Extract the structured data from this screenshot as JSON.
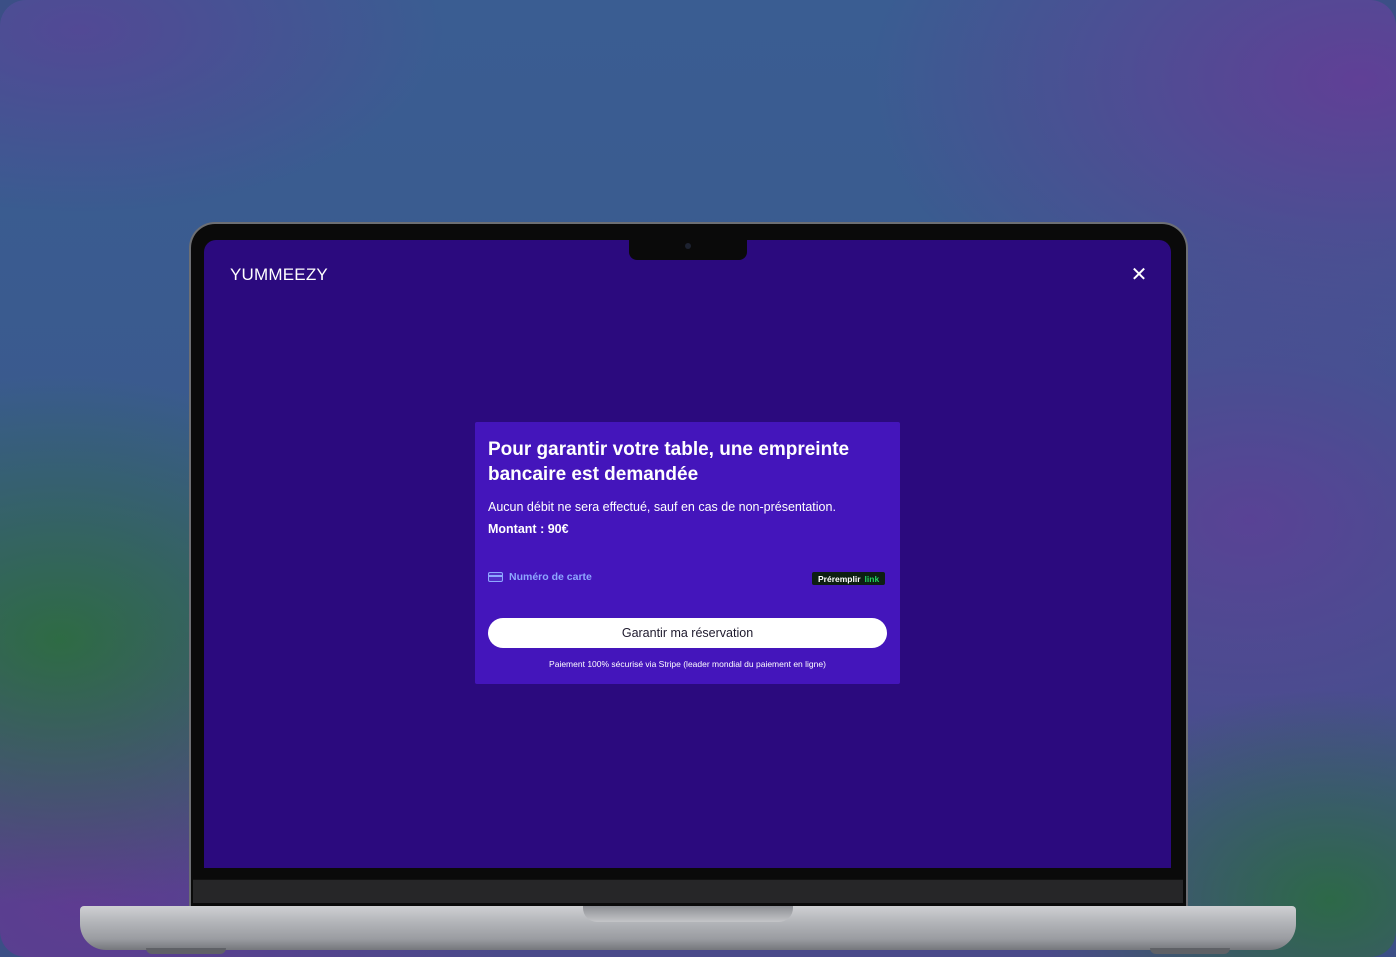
{
  "app": {
    "brand": "YUMMEEZY",
    "close_icon": "close-icon"
  },
  "payment": {
    "title": "Pour garantir votre table, une empreinte bancaire est demandée",
    "description": "Aucun débit ne sera effectué, sauf en cas de non-présentation.",
    "amount_label": "Montant : 90€",
    "card_field_label": "Numéro de carte",
    "card_field_icon": "credit-card-icon",
    "prefill_label": "Préremplir",
    "prefill_link_label": "link",
    "submit_label": "Garantir ma réservation",
    "secure_note": "Paiement 100% sécurisé via Stripe (leader mondial du paiement en ligne)"
  },
  "colors": {
    "screen_background": "#2b0a7e",
    "card_background": "#4415bb",
    "card_field_label": "#8ea7ff",
    "prefill_link": "#20d35f",
    "button_background": "#ffffff"
  }
}
